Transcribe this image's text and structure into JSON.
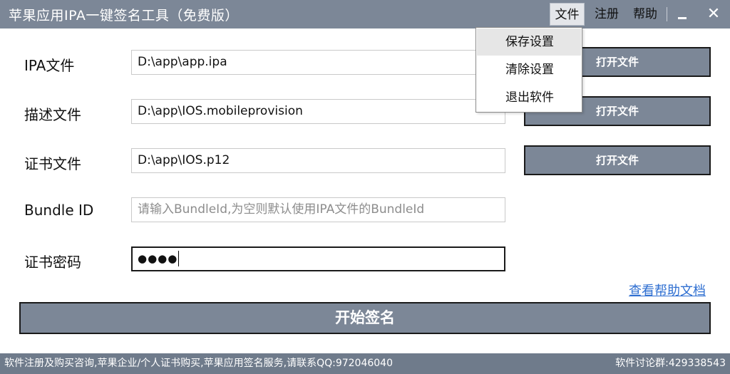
{
  "window": {
    "title": "苹果应用IPA一键签名工具（免费版）"
  },
  "menubar": {
    "file": "文件",
    "register": "注册",
    "help": "帮助",
    "close_glyph": "✕"
  },
  "dropdown": {
    "items": [
      "保存设置",
      "清除设置",
      "退出软件"
    ],
    "hovered": "保存设置"
  },
  "form": {
    "ipa": {
      "label": "IPA文件",
      "value": "D:\\app\\app.ipa",
      "button": "打开文件"
    },
    "profile": {
      "label": "描述文件",
      "value": "D:\\app\\IOS.mobileprovision",
      "button": "打开文件"
    },
    "cert": {
      "label": "证书文件",
      "value": "D:\\app\\IOS.p12",
      "button": "打开文件"
    },
    "bundle": {
      "label": "Bundle ID",
      "placeholder": "请输入BundleId,为空则默认使用IPA文件的BundleId"
    },
    "password": {
      "label": "证书密码",
      "masked": "●●●●"
    }
  },
  "help_link": "查看帮助文档",
  "start_button": "开始签名",
  "statusbar": {
    "left": "软件注册及购买咨询,苹果企业/个人证书购买,苹果应用签名服务,请联系QQ:972046040",
    "right": "软件讨论群:429338543"
  },
  "colors": {
    "titlebar": "#7c8797",
    "button": "#7c8797",
    "statusbar": "#6f7b8b",
    "link": "#2f6fd1"
  },
  "icons": [
    "minimize-icon",
    "close-icon"
  ]
}
